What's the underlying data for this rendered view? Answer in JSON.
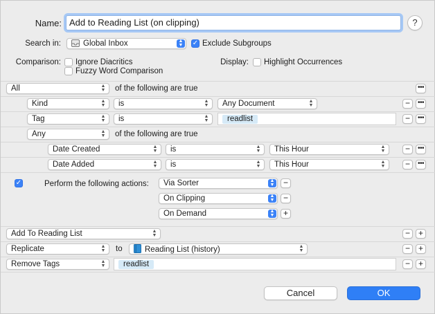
{
  "name_label": "Name:",
  "name_value": "Add to Reading List (on clipping)",
  "help": "?",
  "search_in_label": "Search in:",
  "search_in_value": "Global Inbox",
  "exclude_subgroups": "Exclude Subgroups",
  "comparison_label": "Comparison:",
  "ignore_diacritics": "Ignore Diacritics",
  "fuzzy_word": "Fuzzy Word Comparison",
  "display_label": "Display:",
  "highlight_occurrences": "Highlight Occurrences",
  "rules": {
    "top_match": "All",
    "top_suffix": "of the following are true",
    "kind_field": "Kind",
    "kind_op": "is",
    "kind_value": "Any Document",
    "tag_field": "Tag",
    "tag_op": "is",
    "tag_token": "readlist",
    "any_match": "Any",
    "any_suffix": "of the following are true",
    "created_field": "Date Created",
    "created_op": "is",
    "created_value": "This Hour",
    "added_field": "Date Added",
    "added_op": "is",
    "added_value": "This Hour"
  },
  "perform": {
    "label": "Perform the following actions:",
    "options": [
      "Via Sorter",
      "On Clipping",
      "On Demand"
    ]
  },
  "actions": {
    "add_to": "Add To Reading List",
    "replicate": "Replicate",
    "to": "to",
    "replicate_target": "Reading List (history)",
    "remove_tags": "Remove Tags",
    "remove_token": "readlist"
  },
  "buttons": {
    "cancel": "Cancel",
    "ok": "OK"
  },
  "symbols": {
    "minus": "−",
    "plus": "+",
    "more": "•••",
    "arrows": "▲▼",
    "check": "✓"
  },
  "colors": {
    "accent": "#3b82f7",
    "token_bg": "#d6eaf7"
  }
}
